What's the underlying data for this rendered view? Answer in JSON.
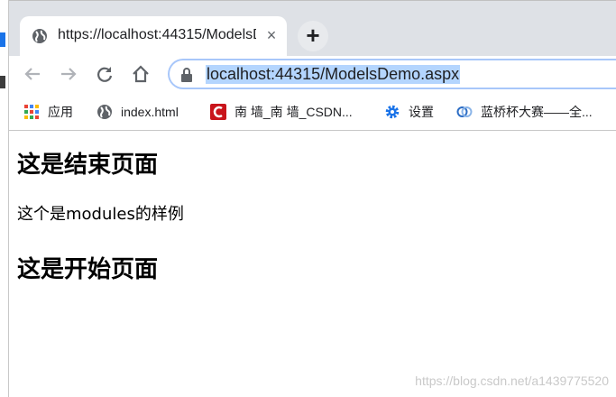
{
  "tab": {
    "title": "https://localhost:44315/ModelsD",
    "close_glyph": "×"
  },
  "new_tab_glyph": "+",
  "address_bar": {
    "url": "localhost:44315/ModelsDemo.aspx"
  },
  "bookmarks": [
    {
      "label": "应用",
      "icon": "apps-grid-icon"
    },
    {
      "label": "index.html",
      "icon": "globe-icon"
    },
    {
      "label": "南 墙_南 墙_CSDN...",
      "icon": "csdn-icon"
    },
    {
      "label": "设置",
      "icon": "gear-icon"
    },
    {
      "label": "蓝桥杯大赛——全...",
      "icon": "lanqiao-icon"
    }
  ],
  "page": {
    "heading_end": "这是结束页面",
    "paragraph": "这个是modules的样例",
    "heading_start": "这是开始页面"
  },
  "watermark": "https://blog.csdn.net/a1439775520",
  "colors": {
    "tabstrip": "#dee1e6",
    "url_highlight": "#b4d5fe",
    "csdn_red": "#c9141b",
    "settings_blue": "#1a73e8"
  }
}
